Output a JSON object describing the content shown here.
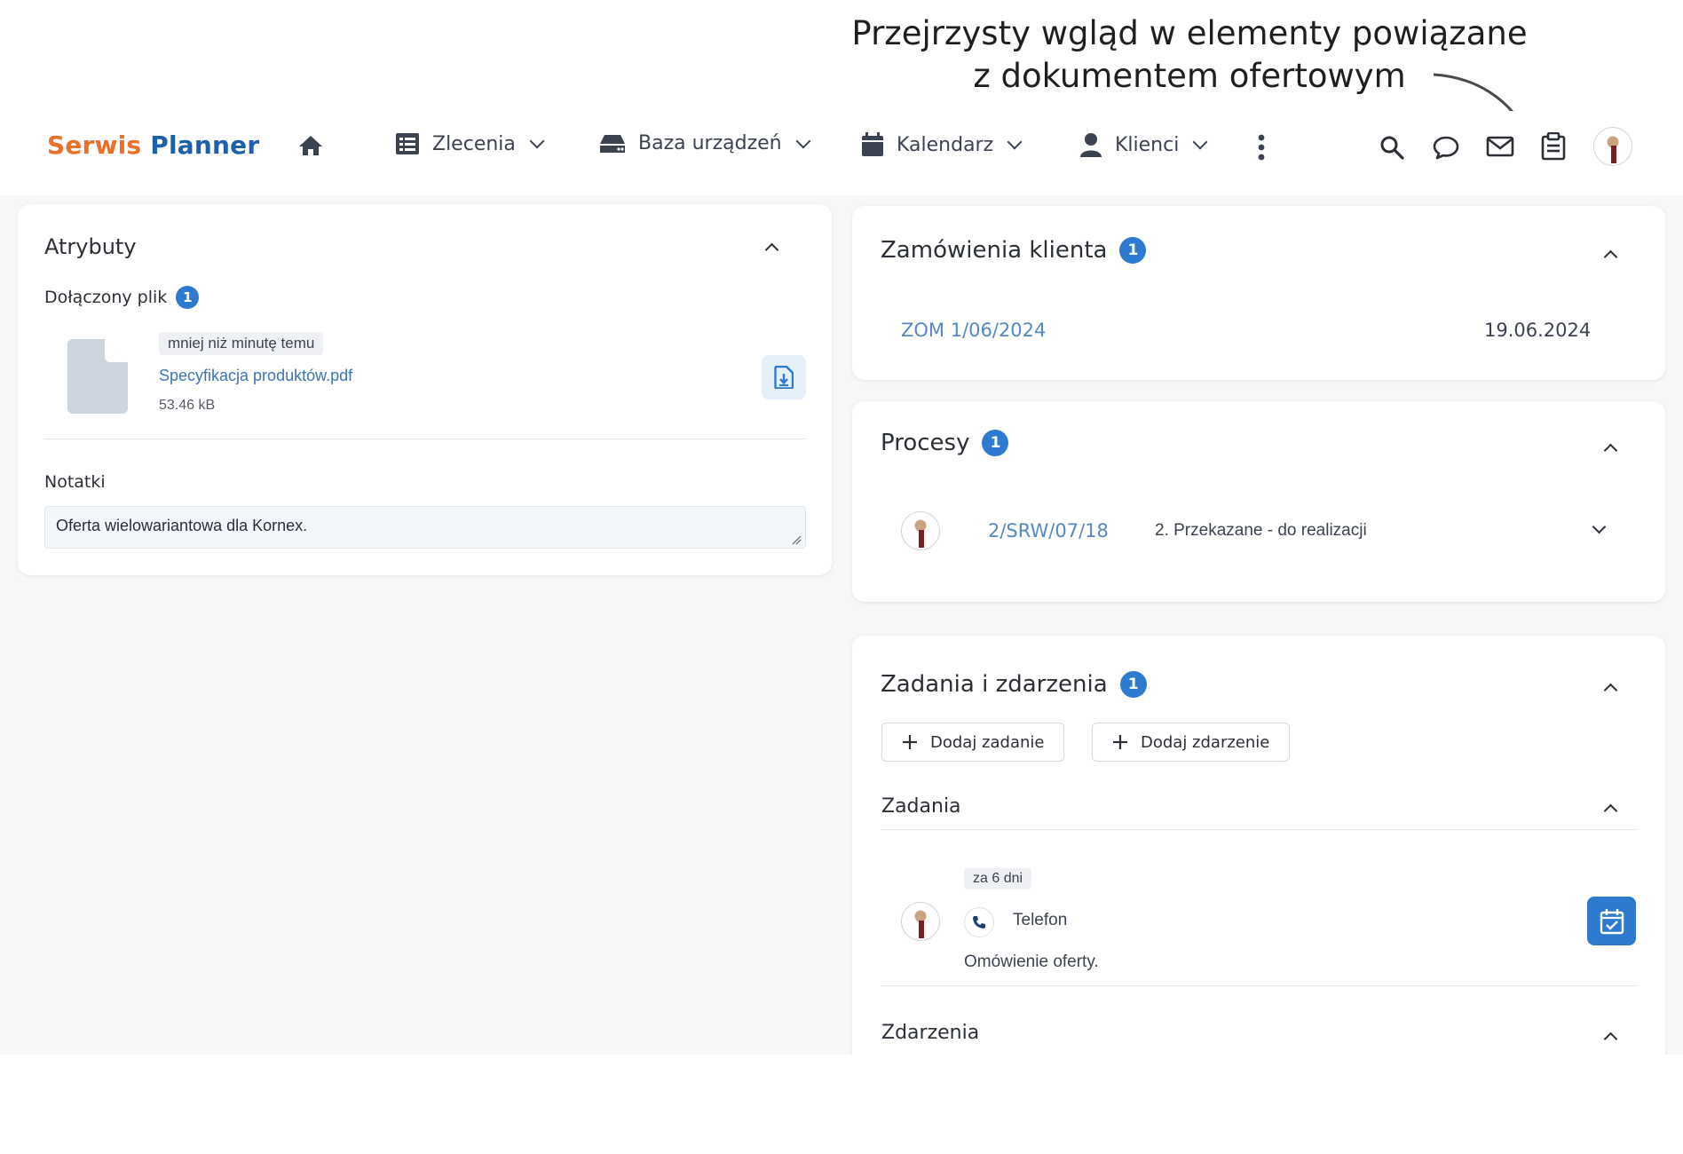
{
  "headline": {
    "line1": "Przejrzysty wgląd w elementy powiązane",
    "line2": "z dokumentem ofertowym"
  },
  "nav": {
    "logo_part1": "Serwis",
    "logo_part2": "Planner",
    "items": [
      {
        "label": "Zlecenia",
        "icon": "list-icon"
      },
      {
        "label": "Baza urządzeń",
        "icon": "device-icon"
      },
      {
        "label": "Kalendarz",
        "icon": "calendar-icon"
      },
      {
        "label": "Klienci",
        "icon": "user-icon"
      }
    ],
    "right_icons": [
      "search-icon",
      "chat-icon",
      "mail-icon",
      "clipboard-icon"
    ]
  },
  "attributes": {
    "title": "Atrybuty",
    "attached_label": "Dołączony plik",
    "attached_count": "1",
    "file": {
      "time_chip": "mniej niż minutę temu",
      "name": "Specyfikacja produktów.pdf",
      "size": "53.46 kB"
    },
    "notes_label": "Notatki",
    "notes_value": "Oferta wielowariantowa dla Kornex."
  },
  "orders": {
    "title": "Zamówienia klienta",
    "count": "1",
    "item": {
      "code": "ZOM 1/06/2024",
      "date": "19.06.2024"
    }
  },
  "processes": {
    "title": "Procesy",
    "count": "1",
    "item": {
      "code": "2/SRW/07/18",
      "status": "2. Przekazane - do realizacji"
    }
  },
  "tasks": {
    "title": "Zadania i zdarzenia",
    "count": "1",
    "add_task": "Dodaj zadanie",
    "add_event": "Dodaj zdarzenie",
    "tasks_label": "Zadania",
    "task": {
      "due": "za 6 dni",
      "type": "Telefon",
      "description": "Omówienie oferty."
    },
    "events_label": "Zdarzenia"
  },
  "colors": {
    "accent": "#2e7ad1",
    "logo_orange": "#e8702a",
    "logo_blue": "#1d5fa8"
  }
}
